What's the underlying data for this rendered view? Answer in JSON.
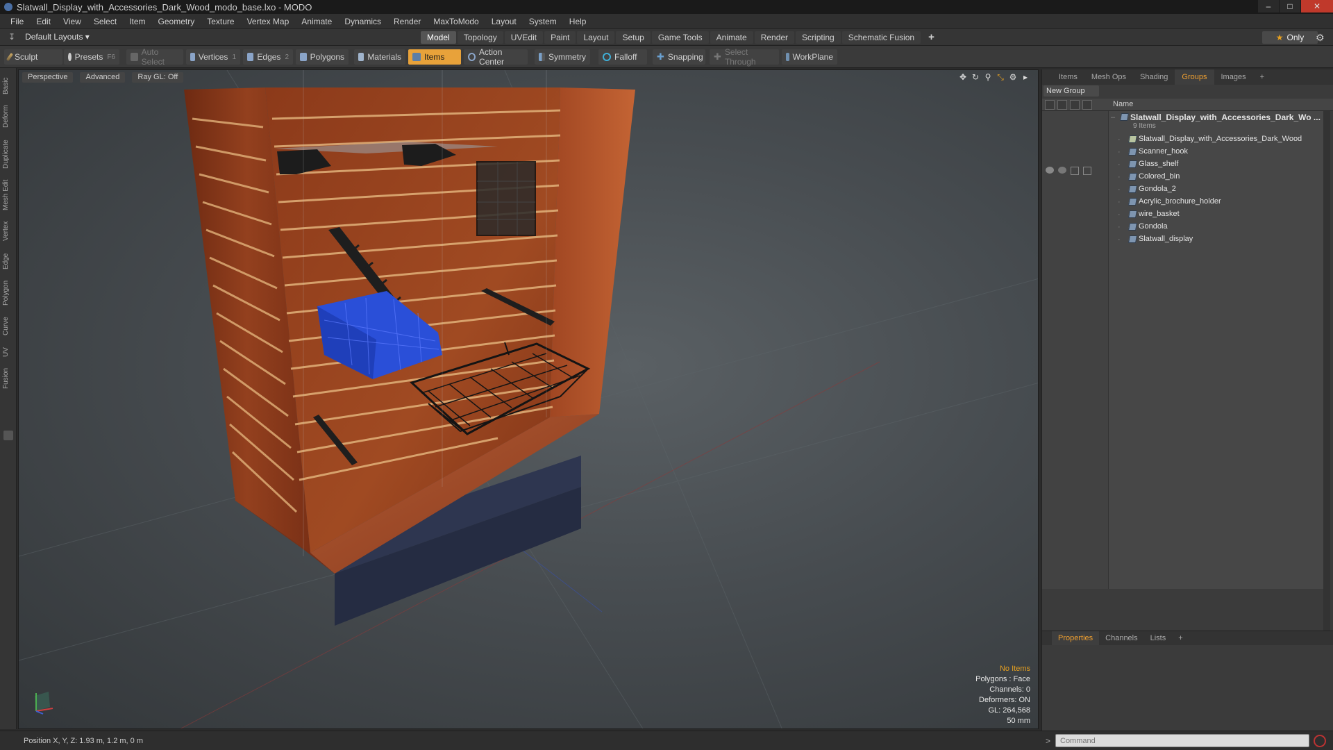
{
  "window": {
    "title": "Slatwall_Display_with_Accessories_Dark_Wood_modo_base.lxo - MODO"
  },
  "menu": [
    "File",
    "Edit",
    "View",
    "Select",
    "Item",
    "Geometry",
    "Texture",
    "Vertex Map",
    "Animate",
    "Dynamics",
    "Render",
    "MaxToModo",
    "Layout",
    "System",
    "Help"
  ],
  "layout": {
    "dropdown": "Default Layouts ▾"
  },
  "mode_tabs": [
    "Model",
    "Topology",
    "UVEdit",
    "Paint",
    "Layout",
    "Setup",
    "Game Tools",
    "Animate",
    "Render",
    "Scripting",
    "Schematic Fusion"
  ],
  "mode_tabs_plus": "+",
  "only_button": "Only",
  "toolbar": {
    "sculpt": "Sculpt",
    "presets": "Presets",
    "presets_key": "F6",
    "auto_select": "Auto Select",
    "vertices": "Vertices",
    "vertices_key": "1",
    "edges": "Edges",
    "edges_key": "2",
    "polygons": "Polygons",
    "materials": "Materials",
    "items": "Items",
    "action_center": "Action Center",
    "symmetry": "Symmetry",
    "falloff": "Falloff",
    "snapping": "Snapping",
    "select_through": "Select Through",
    "workplane": "WorkPlane"
  },
  "left_tabs": [
    "Basic",
    "Deform",
    "Duplicate",
    "Mesh Edit",
    "Vertex",
    "Edge",
    "Polygon",
    "Curve",
    "UV",
    "Fusion"
  ],
  "viewport": {
    "view": "Perspective",
    "shading": "Advanced",
    "raygl": "Ray GL: Off",
    "info": {
      "selection": "No Items",
      "polygons": "Polygons : Face",
      "channels": "Channels: 0",
      "deformers": "Deformers: ON",
      "gl": "GL: 264,568",
      "scale": "50 mm"
    }
  },
  "right_panel": {
    "tabs": [
      "Items",
      "Mesh Ops",
      "Shading",
      "Groups",
      "Images",
      "+"
    ],
    "active_tab": "Groups",
    "new_group": "New Group",
    "column_name": "Name",
    "root": "Slatwall_Display_with_Accessories_Dark_Wo ...",
    "root_count": "9 Items",
    "items": [
      "Slatwall_Display_with_Accessories_Dark_Wood",
      "Scanner_hook",
      "Glass_shelf",
      "Colored_bin",
      "Gondola_2",
      "Acrylic_brochure_holder",
      "wire_basket",
      "Gondola",
      "Slatwall_display"
    ]
  },
  "props_panel": {
    "tabs": [
      "Properties",
      "Channels",
      "Lists",
      "+"
    ]
  },
  "status": {
    "position": "Position X, Y, Z:  1.93 m, 1.2 m, 0 m",
    "command_placeholder": "Command"
  },
  "colors": {
    "accent": "#e8a23a",
    "bin_blue": "#2a4fd8",
    "wood": "#8a3a1c"
  }
}
